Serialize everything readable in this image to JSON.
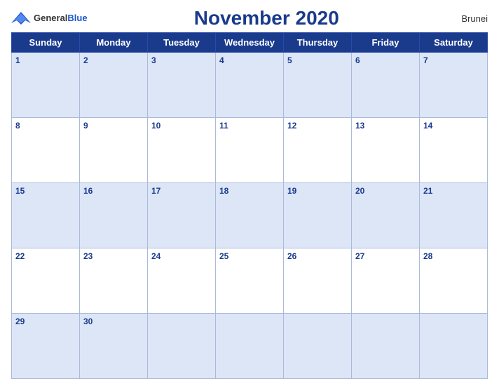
{
  "header": {
    "logo_general": "General",
    "logo_blue": "Blue",
    "title": "November 2020",
    "country": "Brunei"
  },
  "weekdays": [
    "Sunday",
    "Monday",
    "Tuesday",
    "Wednesday",
    "Thursday",
    "Friday",
    "Saturday"
  ],
  "weeks": [
    [
      {
        "day": 1
      },
      {
        "day": 2
      },
      {
        "day": 3
      },
      {
        "day": 4
      },
      {
        "day": 5
      },
      {
        "day": 6
      },
      {
        "day": 7
      }
    ],
    [
      {
        "day": 8
      },
      {
        "day": 9
      },
      {
        "day": 10
      },
      {
        "day": 11
      },
      {
        "day": 12
      },
      {
        "day": 13
      },
      {
        "day": 14
      }
    ],
    [
      {
        "day": 15
      },
      {
        "day": 16
      },
      {
        "day": 17
      },
      {
        "day": 18
      },
      {
        "day": 19
      },
      {
        "day": 20
      },
      {
        "day": 21
      }
    ],
    [
      {
        "day": 22
      },
      {
        "day": 23
      },
      {
        "day": 24
      },
      {
        "day": 25
      },
      {
        "day": 26
      },
      {
        "day": 27
      },
      {
        "day": 28
      }
    ],
    [
      {
        "day": 29
      },
      {
        "day": 30
      },
      {
        "day": null
      },
      {
        "day": null
      },
      {
        "day": null
      },
      {
        "day": null
      },
      {
        "day": null
      }
    ]
  ],
  "colors": {
    "header_bg": "#1a3a8c",
    "odd_row_bg": "#dce6f7",
    "even_row_bg": "#ffffff",
    "text_blue": "#1a3a8c"
  }
}
